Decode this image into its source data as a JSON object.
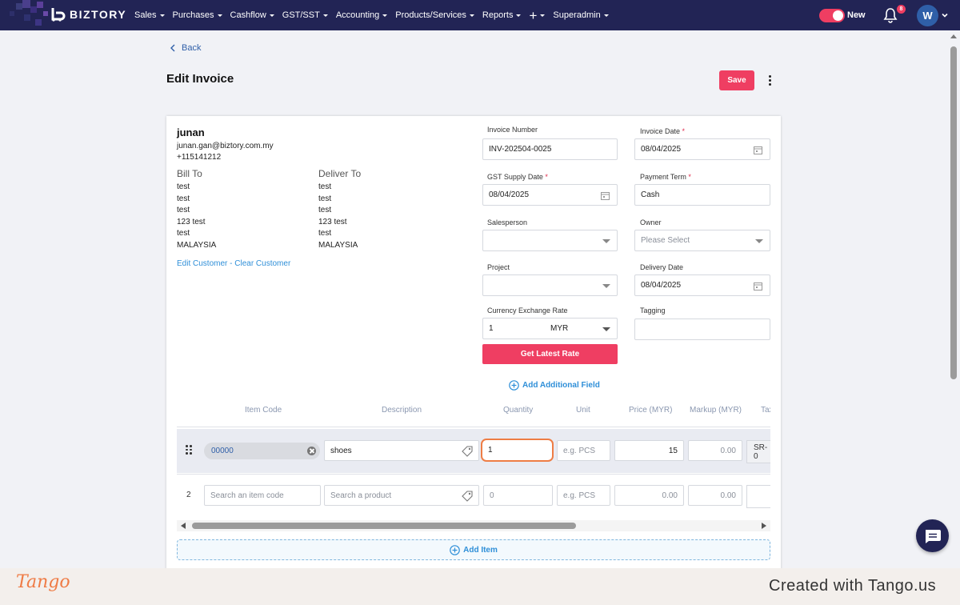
{
  "brand": {
    "name": "BIZTORY",
    "accent": "#ef3e62",
    "nav_bg": "#222455"
  },
  "nav": {
    "items": [
      "Sales",
      "Purchases",
      "Cashflow",
      "GST/SST",
      "Accounting",
      "Products/Services",
      "Reports",
      "+",
      "Superadmin"
    ],
    "toggle_label": "New",
    "notification_count": "8",
    "avatar_initial": "W"
  },
  "header": {
    "back_label": "Back",
    "title": "Edit Invoice",
    "save_label": "Save"
  },
  "customer": {
    "name": "junan",
    "email": "junan.gan@biztory.com.my",
    "phone": "+115141212",
    "bill_to": {
      "heading": "Bill To",
      "lines": [
        "test",
        "test",
        "test",
        "123 test",
        "test",
        "MALAYSIA"
      ]
    },
    "deliver_to": {
      "heading": "Deliver To",
      "lines": [
        "test",
        "test",
        "test",
        "123 test",
        "test",
        "MALAYSIA"
      ]
    },
    "edit_link": "Edit Customer",
    "separator": " - ",
    "clear_link": "Clear Customer"
  },
  "form": {
    "invoice_number": {
      "label": "Invoice Number",
      "value": "INV-202504-0025"
    },
    "invoice_date": {
      "label": "Invoice Date",
      "value": "08/04/2025"
    },
    "gst_supply_date": {
      "label": "GST Supply Date",
      "value": "08/04/2025"
    },
    "payment_term": {
      "label": "Payment Term",
      "value": "Cash"
    },
    "salesperson": {
      "label": "Salesperson",
      "value": ""
    },
    "owner": {
      "label": "Owner",
      "placeholder": "Please Select"
    },
    "project": {
      "label": "Project",
      "value": ""
    },
    "delivery_date": {
      "label": "Delivery Date",
      "value": "08/04/2025"
    },
    "currency": {
      "label": "Currency Exchange Rate",
      "rate": "1",
      "code": "MYR"
    },
    "tagging": {
      "label": "Tagging",
      "value": ""
    },
    "required_mark": "*",
    "latest_rate_button": "Get Latest Rate",
    "add_field_label": "Add Additional Field"
  },
  "table": {
    "headers": [
      "Item Code",
      "Description",
      "Quantity",
      "Unit",
      "Price (MYR)",
      "Markup (MYR)",
      "Tax"
    ],
    "rows": [
      {
        "item_code": "00000",
        "description": "shoes",
        "quantity": "1",
        "unit_placeholder": "e.g. PCS",
        "price": "15",
        "markup": "0.00",
        "tax": "SR-0"
      },
      {
        "number": "2",
        "item_code_placeholder": "Search an item code",
        "description_placeholder": "Search a product",
        "quantity": "0",
        "unit_placeholder": "e.g. PCS",
        "price": "0.00",
        "markup": "0.00"
      }
    ],
    "add_item_label": "Add Item"
  },
  "footer": {
    "logo": "Tango",
    "credit": "Created with Tango.us"
  }
}
